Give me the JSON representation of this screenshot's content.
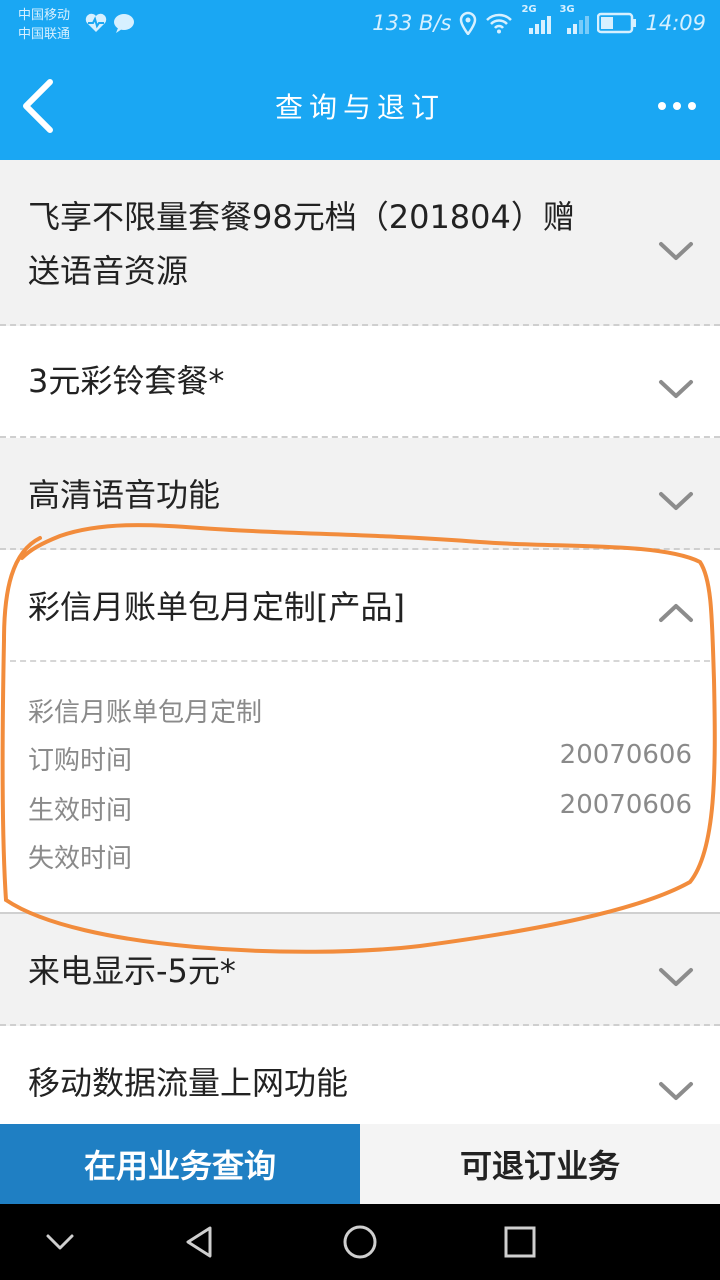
{
  "status_bar": {
    "carrier_1": "中国移动",
    "carrier_2": "中国联通",
    "speed": "133 B/s",
    "net_2g": "2G",
    "net_3g": "3G",
    "time": "14:09"
  },
  "header": {
    "title": "查询与退订",
    "back_icon": "chevron-left-icon",
    "more_icon": "more-dots-icon"
  },
  "list": {
    "items": [
      {
        "label_line1": "飞享不限量套餐98元档（201804）赠",
        "label_line2": "送语音资源",
        "expanded": false
      },
      {
        "label": "3元彩铃套餐*",
        "expanded": false
      },
      {
        "label": "高清语音功能",
        "expanded": false
      },
      {
        "label": "彩信月账单包月定制[产品]",
        "expanded": true,
        "detail": {
          "name": "彩信月账单包月定制",
          "order_time_label": "订购时间",
          "order_time_value": "20070606",
          "effective_time_label": "生效时间",
          "effective_time_value": "20070606",
          "expire_time_label": "失效时间",
          "expire_time_value": ""
        }
      },
      {
        "label": "来电显示-5元*",
        "expanded": false
      },
      {
        "label": "移动数据流量上网功能",
        "expanded": false
      }
    ]
  },
  "tabs": {
    "active": "在用业务查询",
    "inactive": "可退订业务"
  },
  "colors": {
    "primary": "#1aa7f3",
    "tab_active": "#1f7fc3",
    "annotation": "#f28c3c"
  }
}
